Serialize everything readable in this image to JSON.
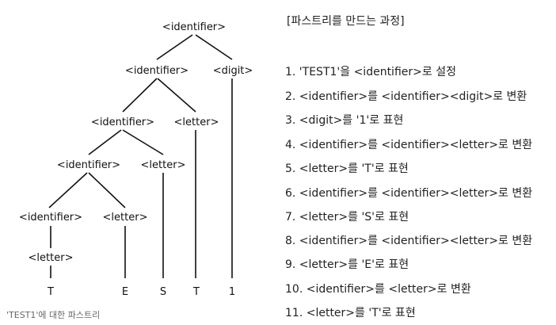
{
  "tree": {
    "nodes": {
      "n_root": "<identifier>",
      "n_id2": "<identifier>",
      "n_digit": "<digit>",
      "n_id3": "<identifier>",
      "n_letter3": "<letter>",
      "n_id4": "<identifier>",
      "n_letter4": "<letter>",
      "n_id5": "<identifier>",
      "n_letter5": "<letter>",
      "n_letter6": "<letter>",
      "leaf_T1": "T",
      "leaf_E": "E",
      "leaf_S": "S",
      "leaf_T2": "T",
      "leaf_1": "1"
    },
    "caption": "'TEST1'에 대한 파스트리"
  },
  "steps": {
    "title": "[파스트리를 만드는 과정]",
    "items": [
      "1. 'TEST1'을 <identifier>로 설정",
      "2. <identifier>를 <identifier><digit>로 변환",
      "3. <digit>를 '1'로 표현",
      "4. <identifier>를 <identifier><letter>로 변환",
      "5. <letter>를 'T'로 표현",
      "6. <identifier>를 <identifier><letter>로 변환",
      "7. <letter>를 'S'로 표현",
      "8. <identifier>를 <identifier><letter>로 변환",
      "9. <letter>를 'E'로 표현",
      "10. <identifier>를 <letter>로 변환",
      "11. <letter>를 'T'로 표현"
    ]
  }
}
